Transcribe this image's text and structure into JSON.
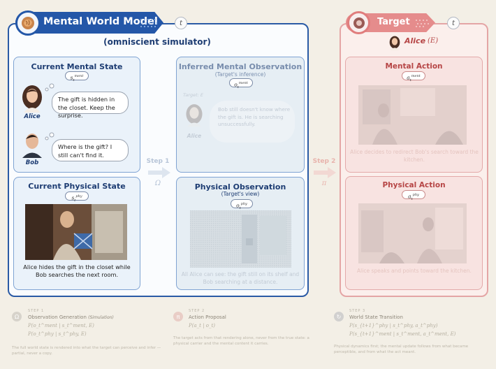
{
  "left_panel": {
    "title": "Mental World Model",
    "time_badge": "t",
    "subtitle": "(omniscient simulator)",
    "current_mental_state": {
      "title": "Current Mental State",
      "label": "s",
      "label_sub": "t",
      "label_sup": "ment",
      "agents": [
        {
          "name": "Alice",
          "speech": "The gift is hidden in the closet. Keep the surprise."
        },
        {
          "name": "Bob",
          "speech": "Where is the gift? I still can't find it."
        }
      ]
    },
    "current_physical_state": {
      "title": "Current Physical State",
      "label": "s",
      "label_sub": "t",
      "label_sup": "phy",
      "caption": "Alice hides the gift in the closet while Bob searches the next room."
    },
    "step1": {
      "label": "Step 1",
      "symbol": "Ω"
    },
    "inferred_mental_observation": {
      "title": "Inferred Mental Observation",
      "subtitle": "(Target's inference)",
      "label": "o",
      "label_sub": "t",
      "label_sup": "ment",
      "agent_tag": "Target: E",
      "agent_name": "Alice",
      "thought": "Bob still doesn't know where the gift is. He is searching unsuccessfully."
    },
    "physical_observation": {
      "title": "Physical Observation",
      "subtitle": "(Target's view)",
      "label": "o",
      "label_sub": "t",
      "label_sup": "phy",
      "caption": "All Alice can see: the gift still on its shelf and Bob searching at a distance."
    }
  },
  "step2": {
    "label": "Step 2",
    "symbol": "π"
  },
  "right_panel": {
    "title": "Target",
    "time_badge": "t",
    "agent_name": "Alice",
    "agent_symbol": "(E)",
    "mental_action": {
      "title": "Mental Action",
      "label": "a",
      "label_sub": "t",
      "label_sup": "ment",
      "caption": "Alice decides to redirect Bob's search toward the kitchen."
    },
    "physical_action": {
      "title": "Physical Action",
      "label": "a",
      "label_sub": "t",
      "label_sup": "phy",
      "caption": "Alice speaks and points toward the kitchen."
    }
  },
  "legend": [
    {
      "num": "STEP 1",
      "title": "Observation Generation",
      "tag": "(Simulation)",
      "formula": "P(o_t^ment | s_t^ment, E)",
      "formula2": "P(o_t^phy | s_t^phy, E)",
      "desc": "The full world state is rendered into what the target can perceive and infer — partial, never a copy."
    },
    {
      "num": "STEP 2",
      "title": "Action Proposal",
      "tag": "",
      "formula": "P(a_t | o_t)",
      "formula2": "",
      "desc": "The target acts from that rendering alone, never from the true state: a physical carrier and the mental content it carries."
    },
    {
      "num": "STEP 3",
      "title": "World State Transition",
      "tag": "",
      "formula": "P(s_{t+1}^phy | s_t^phy, a_t^phy)",
      "formula2": "P(s_{t+1}^ment | s_t^ment, a_t^ment, E)",
      "desc": "Physical dynamics first; the mental update follows from what became perceptible, and from what the act meant."
    }
  ],
  "colors": {
    "blue": "#2457a8",
    "red": "#e58c8c",
    "bg": "#f3efe6"
  }
}
